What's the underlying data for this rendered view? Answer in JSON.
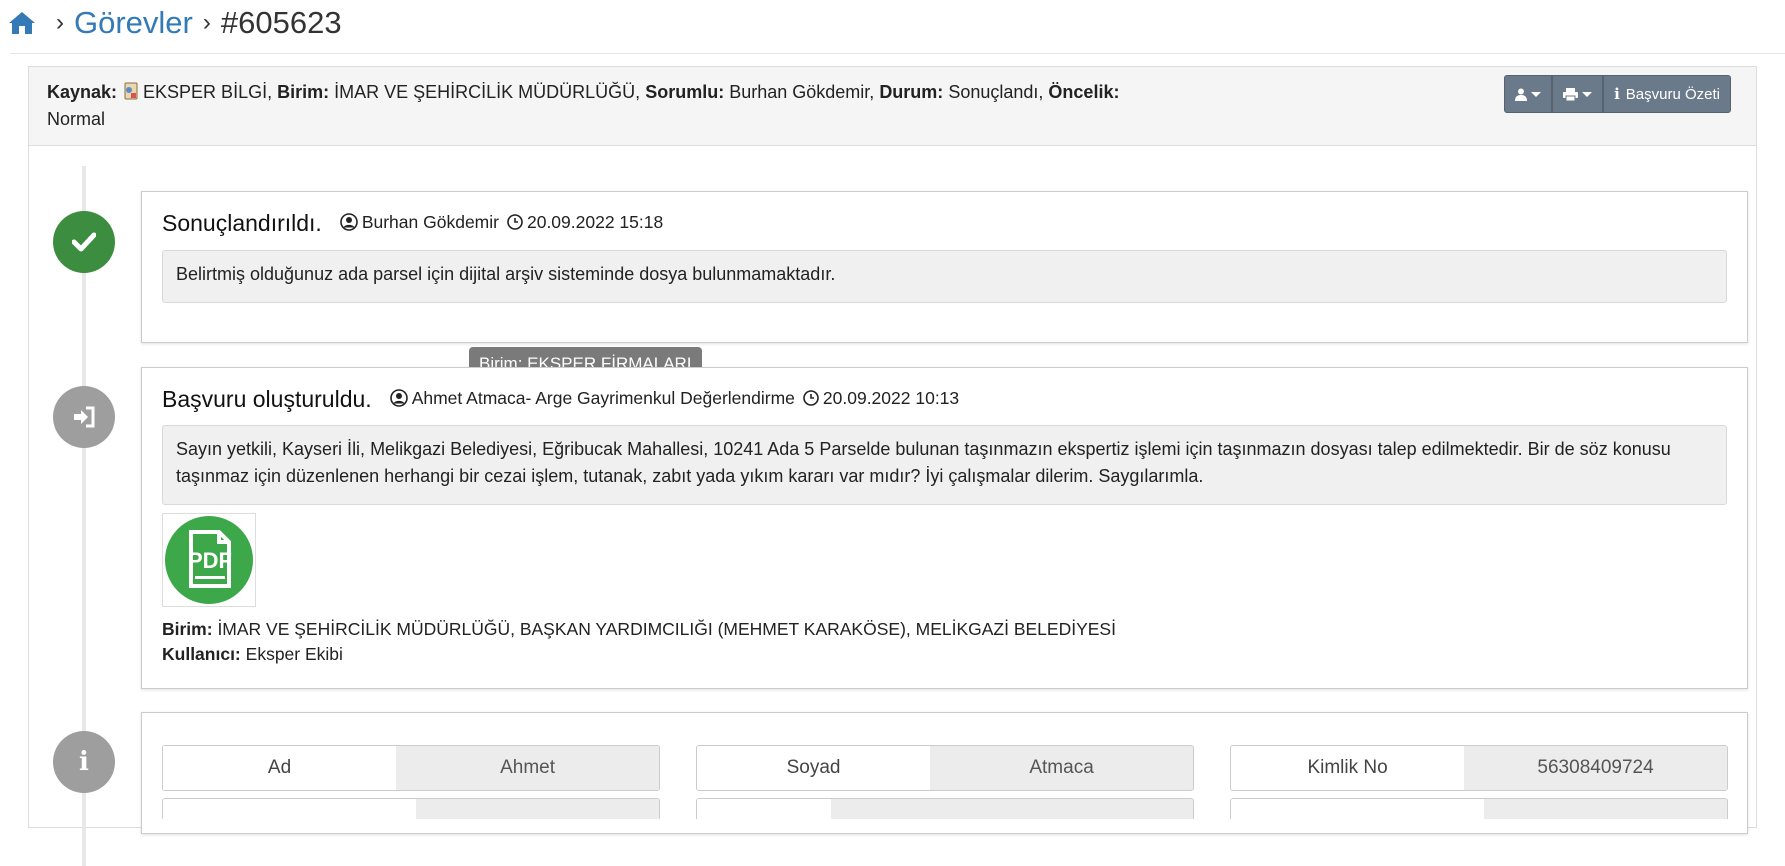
{
  "breadcrumb": {
    "section": "Görevler",
    "id": "#605623"
  },
  "header": {
    "kaynak_label": "Kaynak:",
    "kaynak": "EKSPER BİLGİ,",
    "birim_label": "Birim:",
    "birim": "İMAR VE ŞEHİRCİLİK MÜDÜRLÜĞÜ,",
    "sorumlu_label": "Sorumlu:",
    "sorumlu": "Burhan Gökdemir,",
    "durum_label": "Durum:",
    "durum": "Sonuçlandı,",
    "oncelik_label": "Öncelik:",
    "oncelik": "Normal",
    "ozet_button": "Başvuru Özeti"
  },
  "timeline": [
    {
      "title": "Sonuçlandırıldı.",
      "user": "Burhan Gökdemir",
      "datetime": "20.09.2022 15:18",
      "text": "Belirtmiş olduğunuz ada parsel için dijital arşiv sisteminde dosya bulunmamaktadır.",
      "color": "#3c8d3f"
    },
    {
      "title": "Başvuru oluşturuldu.",
      "user": "Ahmet Atmaca- Arge Gayrimenkul Değerlendirme",
      "datetime": "20.09.2022 10:13",
      "text": "Sayın yetkili, Kayseri İli, Melikgazi Belediyesi, Eğribucak Mahallesi, 10241 Ada 5 Parselde bulunan taşınmazın ekspertiz işlemi için taşınmazın dosyası talep edilmektedir. Bir de söz konusu taşınmaz için düzenlenen herhangi bir cezai işlem, tutanak, zabıt yada yıkım kararı var mıdır? İyi çalışmalar dilerim. Saygılarımla.",
      "tooltip": "Birim: EKSPER FİRMALARI",
      "attachment": "PDF",
      "birim_label": "Birim:",
      "birim": "İMAR VE ŞEHİRCİLİK MÜDÜRLÜĞÜ, BAŞKAN YARDIMCILIĞI (MEHMET KARAKÖSE), MELİKGAZİ BELEDİYESİ",
      "kullanici_label": "Kullanıcı:",
      "kullanici": "Eksper Ekibi",
      "color": "#9e9e9e"
    }
  ],
  "applicant": {
    "fields": [
      {
        "label": "Ad",
        "value": "Ahmet"
      },
      {
        "label": "Soyad",
        "value": "Atmaca"
      },
      {
        "label": "Kimlik No",
        "value": "56308409724"
      }
    ]
  }
}
